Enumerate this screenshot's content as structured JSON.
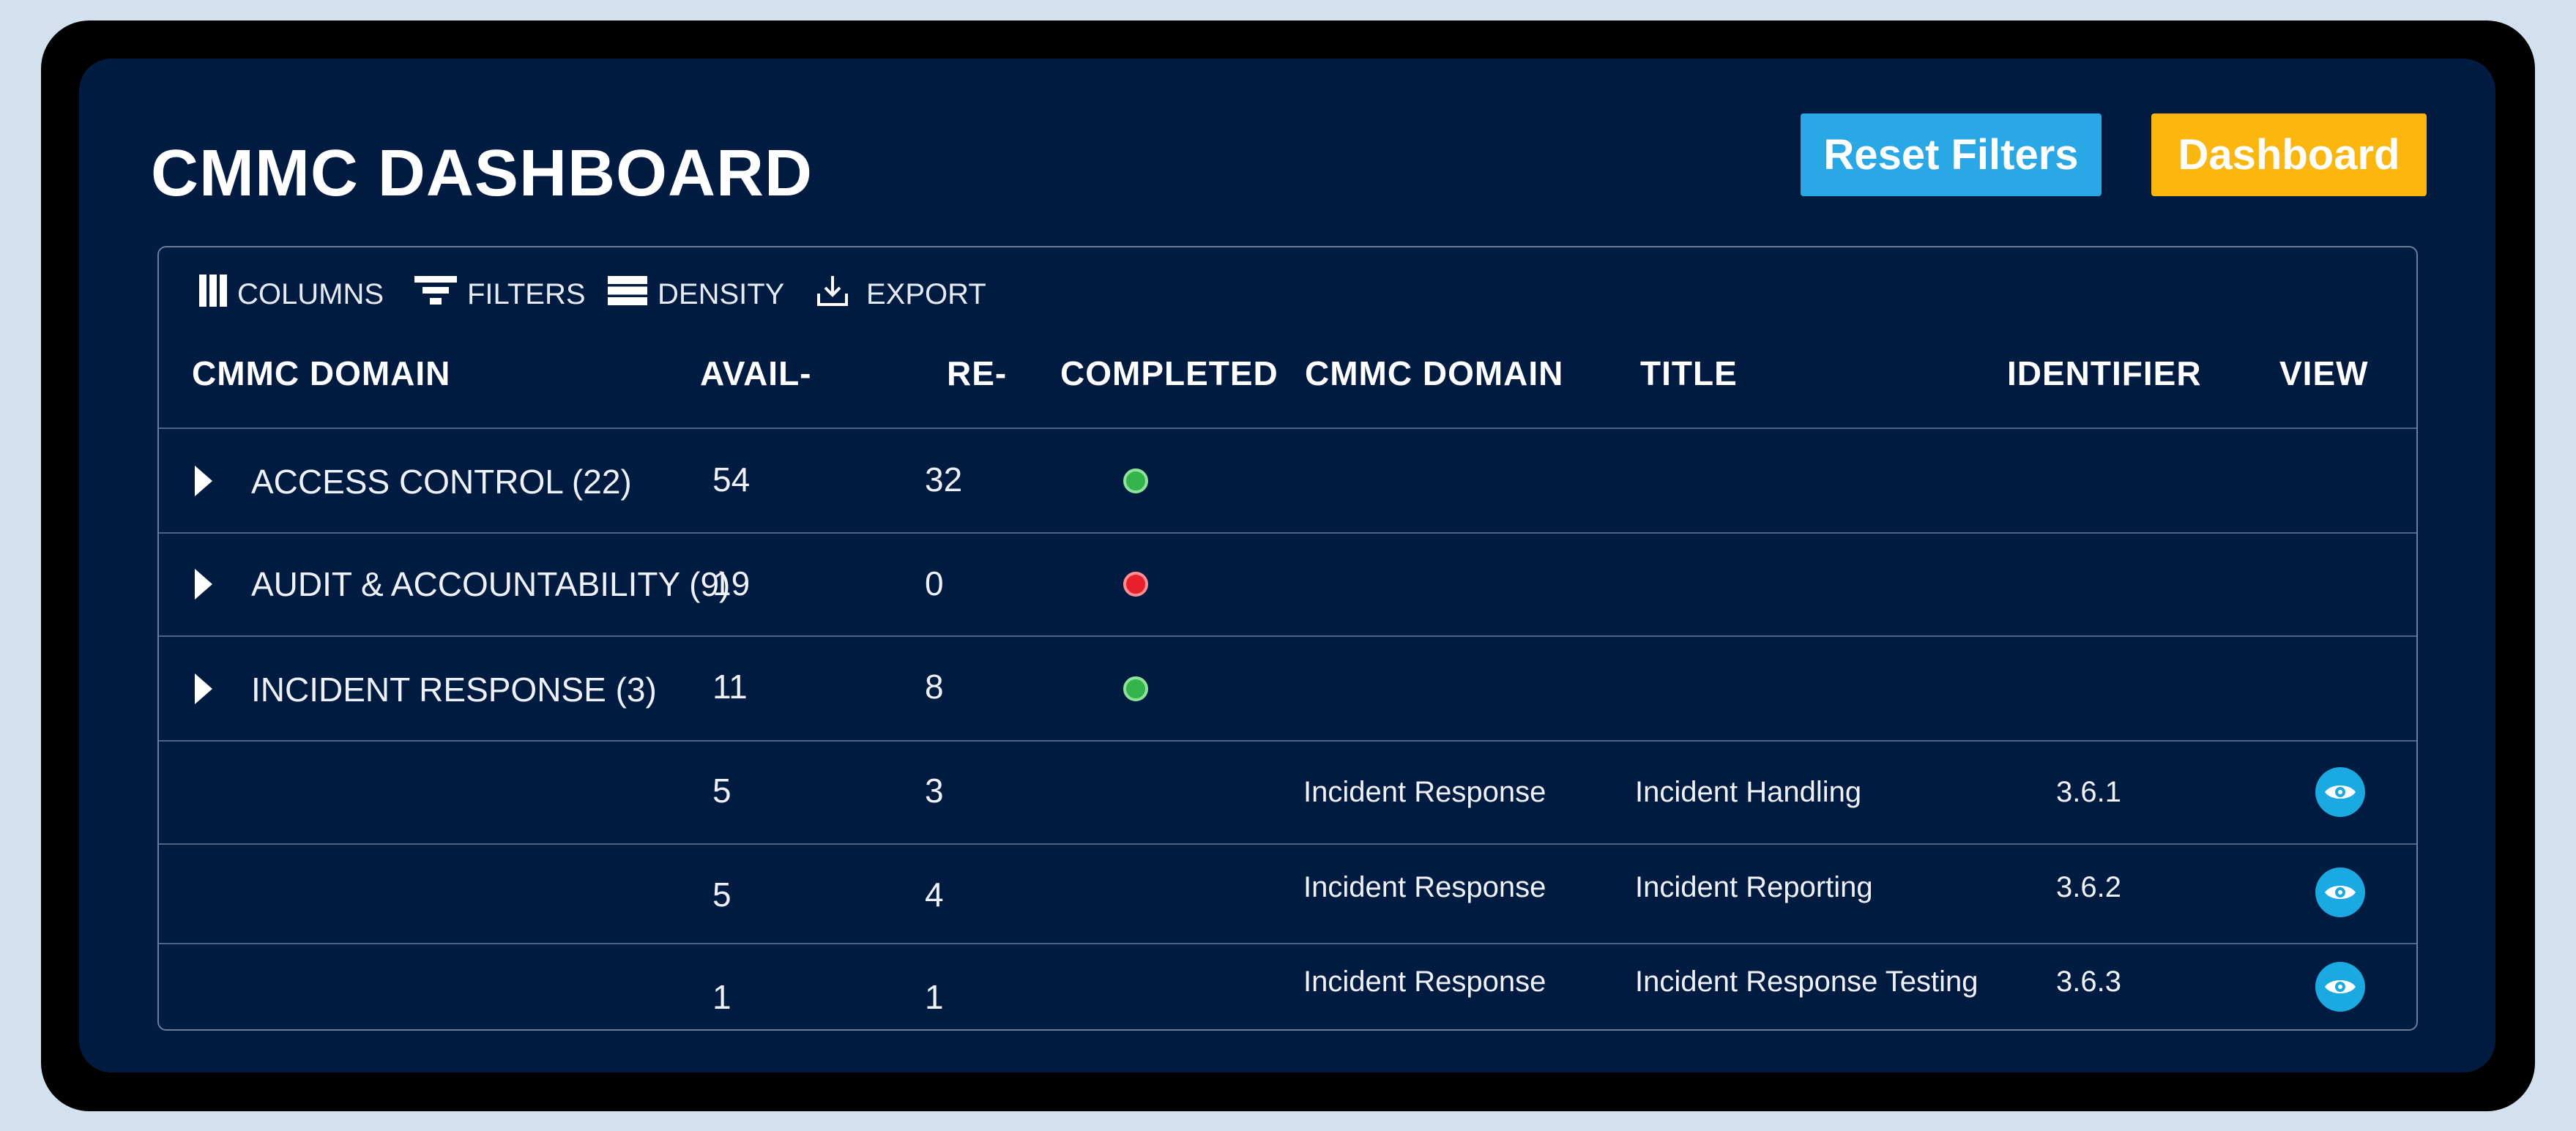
{
  "header": {
    "title": "CMMC DASHBOARD",
    "reset_label": "Reset Filters",
    "dashboard_label": "Dashboard",
    "reset_color": "#2aa8e6",
    "dashboard_color": "#fbb60f"
  },
  "toolbar": {
    "columns": "COLUMNS",
    "filters": "FILTERS",
    "density": "DENSITY",
    "export": "EXPORT"
  },
  "columns": [
    "CMMC DOMAIN",
    "AVAIL-",
    "RE-",
    "COMPLETED",
    "CMMC DOMAIN",
    "TITLE",
    "IDENTIFIER",
    "VIEW"
  ],
  "groups": [
    {
      "domain": "ACCESS CONTROL (22)",
      "avail": "54",
      "re": "32",
      "completed": "green"
    },
    {
      "domain": "AUDIT & ACCOUNTABILITY (9)",
      "avail": "19",
      "re": "0",
      "completed": "red"
    },
    {
      "domain": "INCIDENT RESPONSE (3)",
      "avail": "11",
      "re": "8",
      "completed": "green"
    }
  ],
  "details": [
    {
      "avail": "5",
      "re": "3",
      "domain": "Incident Response",
      "title": "Incident Handling",
      "identifier": "3.6.1",
      "view_icon": "eye-icon"
    },
    {
      "avail": "5",
      "re": "4",
      "domain": "Incident Response",
      "title": "Incident Reporting",
      "identifier": "3.6.2",
      "view_icon": "eye-icon"
    },
    {
      "avail": "1",
      "re": "1",
      "domain": "Incident Response",
      "title": "Incident Response Testing",
      "identifier": "3.6.3",
      "view_icon": "eye-icon"
    }
  ],
  "status_colors": {
    "green": "#34b44a",
    "red": "#e8202c"
  }
}
